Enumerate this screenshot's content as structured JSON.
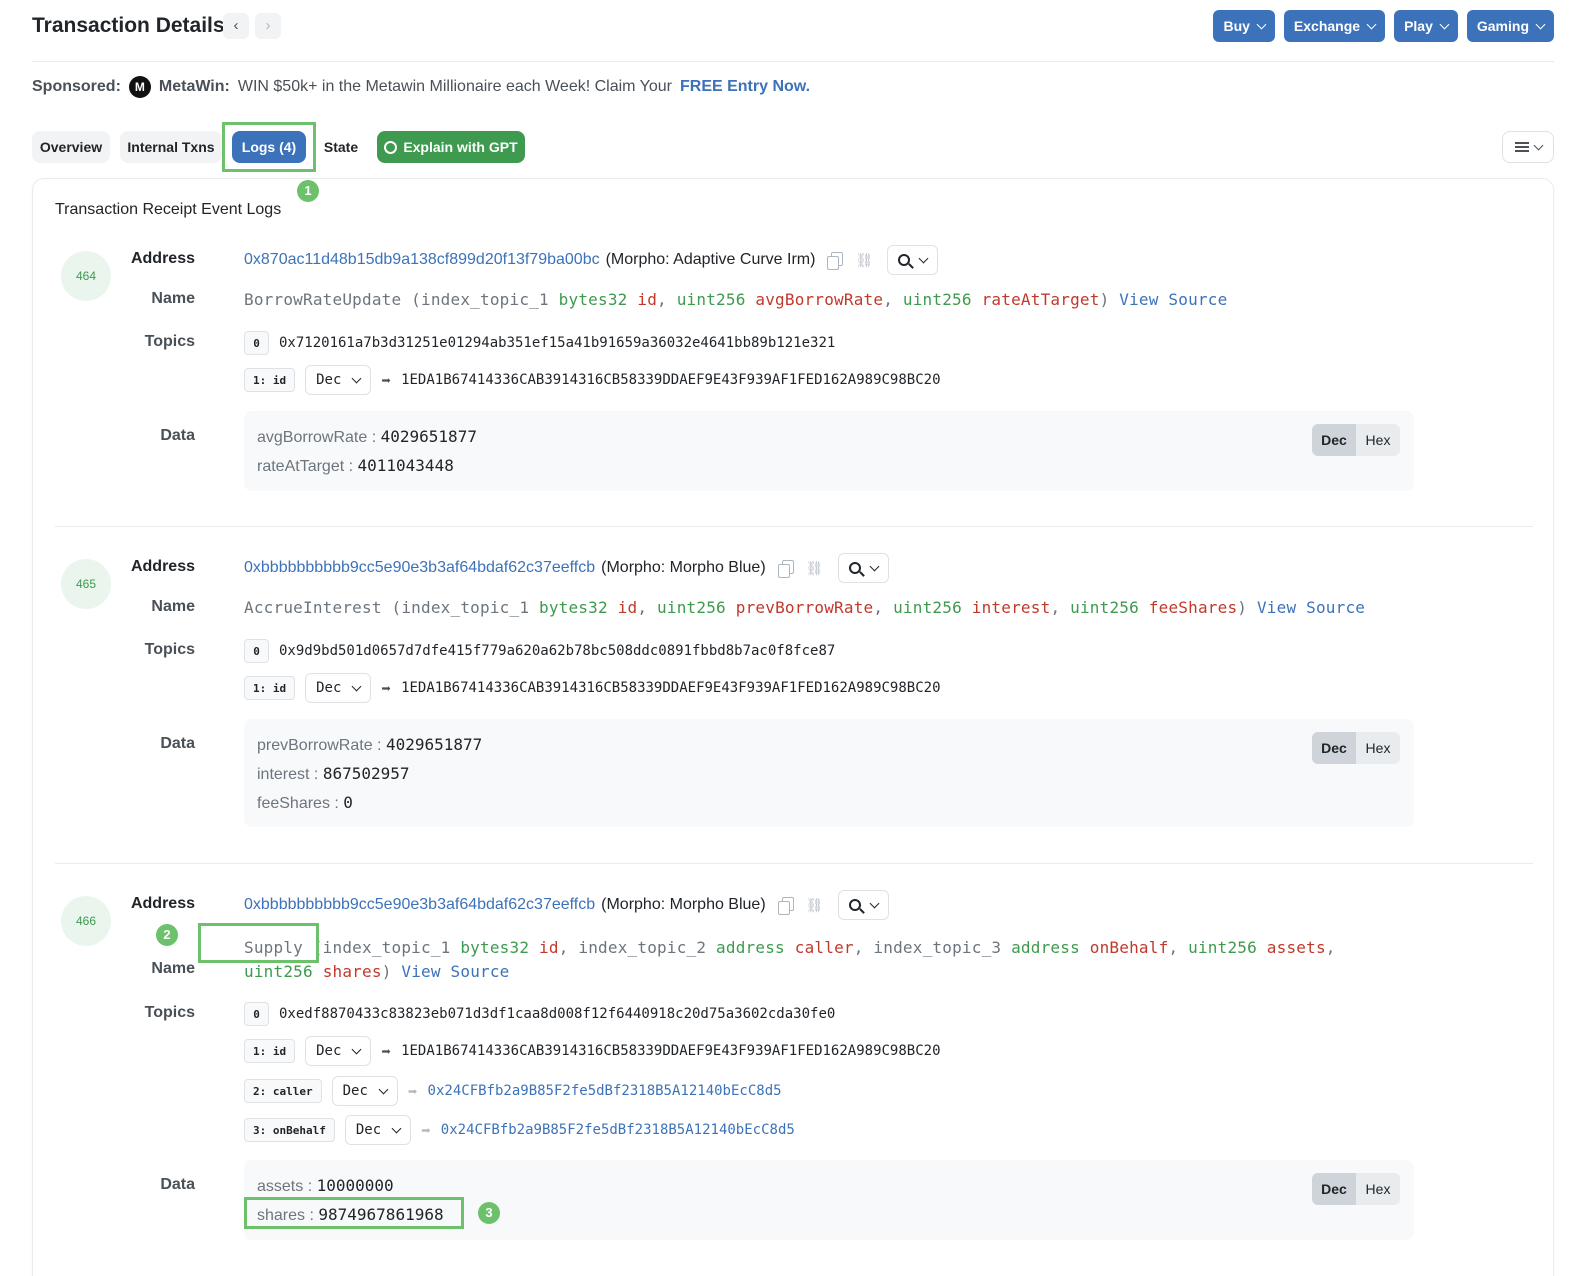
{
  "header": {
    "title": "Transaction Details",
    "menus": [
      "Buy",
      "Exchange",
      "Play",
      "Gaming"
    ]
  },
  "sponsored": {
    "label": "Sponsored:",
    "brand": "MetaWin:",
    "text": "WIN $50k+ in the Metawin Millionaire each Week! Claim Your",
    "cta": "FREE Entry Now."
  },
  "tabs": {
    "overview": "Overview",
    "internal": "Internal Txns",
    "logs": "Logs (4)",
    "state": "State",
    "gpt": "Explain with GPT"
  },
  "card_title": "Transaction Receipt Event Logs",
  "labels": {
    "address": "Address",
    "name": "Name",
    "topics": "Topics",
    "data": "Data",
    "dec": "Dec",
    "hex": "Hex",
    "view_source": "View Source"
  },
  "logs": [
    {
      "index": "464",
      "address": "0x870ac11d48b15db9a138cf899d20f13f79ba00bc",
      "address_name": "(Morpho: Adaptive Curve Irm)",
      "event_name": "BorrowRateUpdate",
      "params": [
        {
          "indexed": "index_topic_1",
          "type": "bytes32",
          "name": "id"
        },
        {
          "type": "uint256",
          "name": "avgBorrowRate"
        },
        {
          "type": "uint256",
          "name": "rateAtTarget"
        }
      ],
      "topic0": "0x7120161a7b3d31251e01294ab351ef15a41b91659a36032e4641bb89b121e321",
      "topic1_label": "1: id",
      "topic1_format": "Dec",
      "topic1_value": "1EDA1B67414336CAB3914316CB58339DDAEF9E43F939AF1FED162A989C98BC20",
      "data": [
        {
          "key": "avgBorrowRate",
          "value": "4029651877"
        },
        {
          "key": "rateAtTarget",
          "value": "4011043448"
        }
      ]
    },
    {
      "index": "465",
      "address": "0xbbbbbbbbbb9cc5e90e3b3af64bdaf62c37eeffcb",
      "address_name": "(Morpho: Morpho Blue)",
      "event_name": "AccrueInterest",
      "params": [
        {
          "indexed": "index_topic_1",
          "type": "bytes32",
          "name": "id"
        },
        {
          "type": "uint256",
          "name": "prevBorrowRate"
        },
        {
          "type": "uint256",
          "name": "interest"
        },
        {
          "type": "uint256",
          "name": "feeShares"
        }
      ],
      "topic0": "0x9d9bd501d0657d7dfe415f779a620a62b78bc508ddc0891fbbd8b7ac0f8fce87",
      "topic1_label": "1: id",
      "topic1_format": "Dec",
      "topic1_value": "1EDA1B67414336CAB3914316CB58339DDAEF9E43F939AF1FED162A989C98BC20",
      "data": [
        {
          "key": "prevBorrowRate",
          "value": "4029651877"
        },
        {
          "key": "interest",
          "value": "867502957"
        },
        {
          "key": "feeShares",
          "value": "0"
        }
      ]
    },
    {
      "index": "466",
      "address": "0xbbbbbbbbbb9cc5e90e3b3af64bdaf62c37eeffcb",
      "address_name": "(Morpho: Morpho Blue)",
      "event_name": "Supply",
      "params": [
        {
          "indexed": "index_topic_1",
          "type": "bytes32",
          "name": "id"
        },
        {
          "indexed": "index_topic_2",
          "type": "address",
          "name": "caller"
        },
        {
          "indexed": "index_topic_3",
          "type": "address",
          "name": "onBehalf"
        },
        {
          "type": "uint256",
          "name": "assets"
        },
        {
          "type": "uint256",
          "name": "shares"
        }
      ],
      "topic0": "0xedf8870433c83823eb071d3df1caa8d008f12f6440918c20d75a3602cda30fe0",
      "topic1_label": "1: id",
      "topic1_format": "Dec",
      "topic1_value": "1EDA1B67414336CAB3914316CB58339DDAEF9E43F939AF1FED162A989C98BC20",
      "topic2_label": "2: caller",
      "topic2_format": "Dec",
      "topic2_value": "0x24CFBfb2a9B85F2fe5dBf2318B5A12140bEcC8d5",
      "topic3_label": "3: onBehalf",
      "topic3_format": "Dec",
      "topic3_value": "0x24CFBfb2a9B85F2fe5dBf2318B5A12140bEcC8d5",
      "data": [
        {
          "key": "assets",
          "value": "10000000"
        },
        {
          "key": "shares",
          "value": "9874967861968"
        }
      ]
    }
  ],
  "annotations": {
    "m1": "1",
    "m2": "2",
    "m3": "3"
  },
  "colors": {
    "primary": "#3c72b9",
    "success": "#3d9a4f",
    "annotation": "#6cc16a",
    "param_type": "#3d9a4f",
    "param_name": "#c0392b"
  },
  "icons": [
    "chevron-left-icon",
    "chevron-right-icon",
    "chevron-down-icon",
    "metawin-logo",
    "gpt-icon",
    "list-view-icon",
    "copy-icon",
    "link-icon",
    "zoom-in-icon",
    "arrow-right-icon"
  ]
}
